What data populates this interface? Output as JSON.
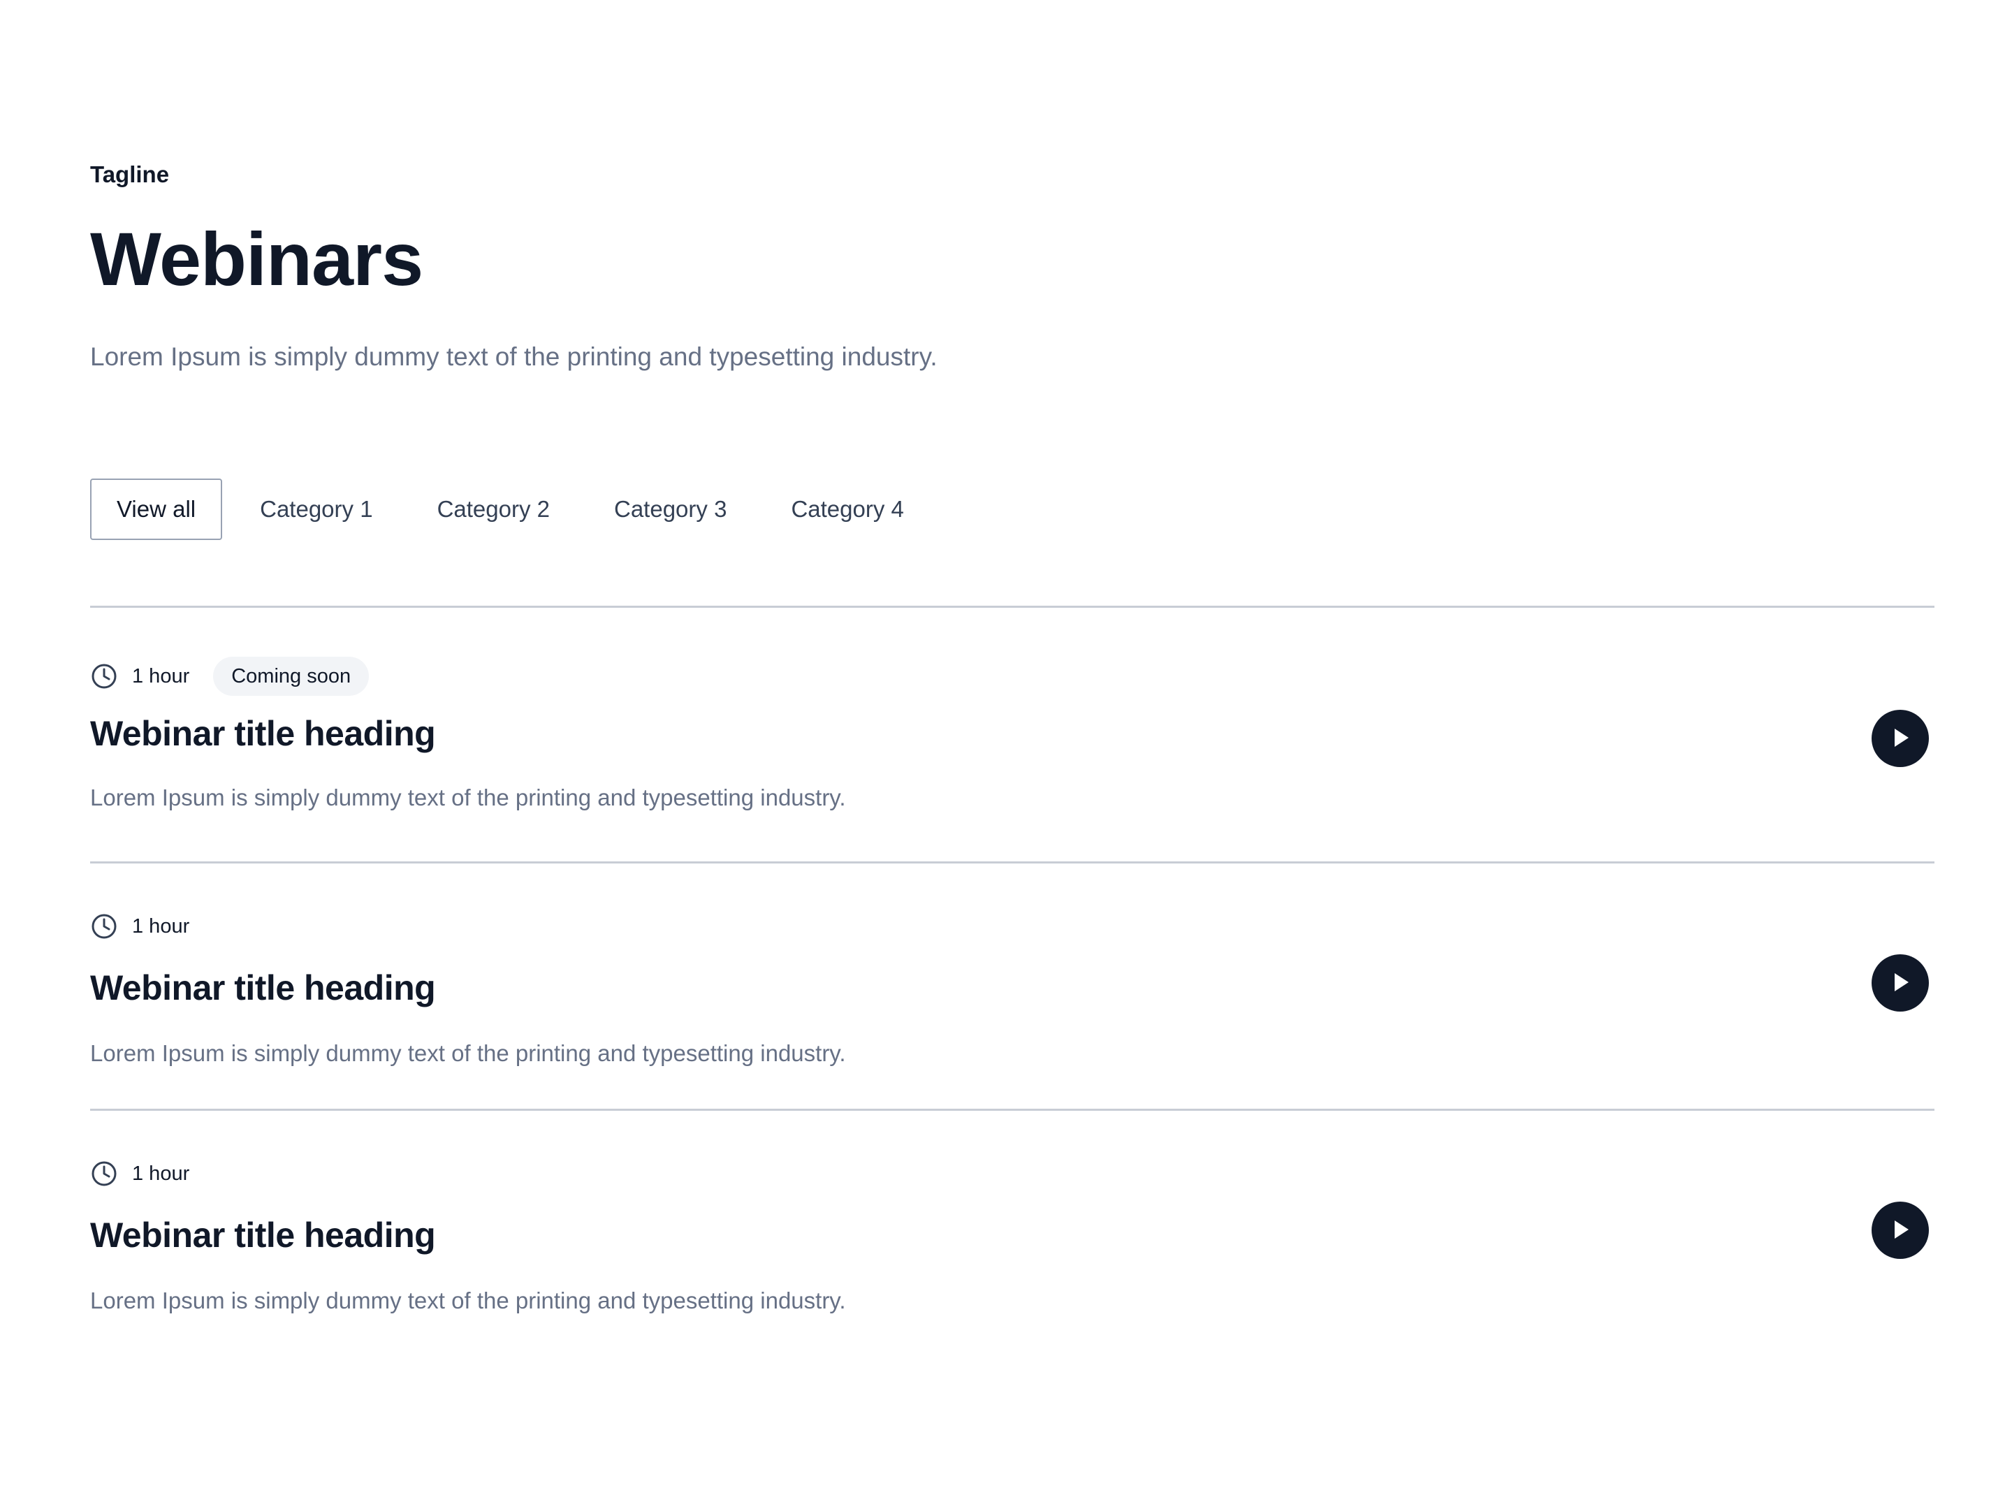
{
  "header": {
    "tagline": "Tagline",
    "title": "Webinars",
    "subtitle": "Lorem Ipsum is simply dummy text of the printing and typesetting industry."
  },
  "tabs": [
    {
      "label": "View all",
      "active": true
    },
    {
      "label": "Category 1",
      "active": false
    },
    {
      "label": "Category 2",
      "active": false
    },
    {
      "label": "Category 3",
      "active": false
    },
    {
      "label": "Category 4",
      "active": false
    }
  ],
  "webinars": [
    {
      "duration": "1 hour",
      "badge": "Coming soon",
      "title": "Webinar title heading",
      "description": "Lorem Ipsum is simply dummy text of the printing and typesetting industry.",
      "icon": "clock-icon",
      "action_icon": "play-icon"
    },
    {
      "duration": "1 hour",
      "title": "Webinar title heading",
      "description": "Lorem Ipsum is simply dummy text of the printing and typesetting industry.",
      "icon": "clock-icon",
      "action_icon": "play-icon"
    },
    {
      "duration": "1 hour",
      "title": "Webinar title heading",
      "description": "Lorem Ipsum is simply dummy text of the printing and typesetting industry.",
      "icon": "clock-icon",
      "action_icon": "play-icon"
    }
  ],
  "colors": {
    "text_primary": "#101828",
    "text_secondary": "#667085",
    "divider": "#c8cdd5",
    "badge_bg": "#f2f4f7",
    "play_bg": "#101828"
  }
}
